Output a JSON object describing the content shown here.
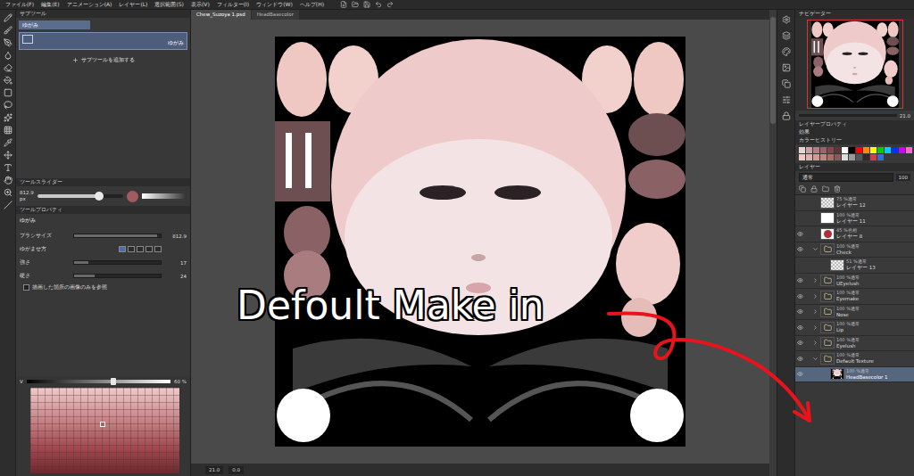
{
  "menu": [
    "ファイル(F)",
    "編集(E)",
    "アニメーション(A)",
    "レイヤー(L)",
    "選択範囲(S)",
    "表示(V)",
    "フィルター(I)",
    "ウィンドウ(W)",
    "ヘルプ(H)"
  ],
  "subtool": {
    "title": "サブツール",
    "group": "ゆがみ",
    "item": "ゆがみ",
    "add": "サブツールを追加する"
  },
  "tool_slider": {
    "title": "ツールスライダー",
    "value": "812.9",
    "unit": "px",
    "level": 0.72
  },
  "tool_property": {
    "title": "ツールプロパティ",
    "tool": "ゆがみ",
    "rows": [
      {
        "kind": "slider",
        "label": "ブラシサイズ",
        "value": "812.9",
        "level": 0.96
      },
      {
        "kind": "mode",
        "label": "ゆがませ方"
      },
      {
        "kind": "slider",
        "label": "強さ",
        "value": "17",
        "level": 0.17
      },
      {
        "kind": "slider",
        "label": "硬さ",
        "value": "24",
        "level": 0.24
      },
      {
        "kind": "checkbox",
        "label": "描画した箇所の画像のみを参照",
        "checked": false
      }
    ]
  },
  "color": {
    "label": "V",
    "value": "60 %",
    "level": 0.6
  },
  "document_tabs": [
    {
      "label": "Chew_Suzoya 1.psd",
      "selected": true
    },
    {
      "label": "HeadBasecolor",
      "selected": false
    }
  ],
  "canvas": {
    "annotation": "Defoult Make in"
  },
  "status": {
    "zoom": "21.0",
    "angle": "0.0"
  },
  "navigator": {
    "title": "ナビゲーター",
    "zoom": "21.0"
  },
  "panels": [
    "レイヤープロパティ",
    "効果",
    "カラーヒストリー"
  ],
  "color_history": [
    "#e8d6d6",
    "#c8a2a4",
    "#b07f83",
    "#9a6468",
    "#7e4a4e",
    "#5e3538",
    "#ffffff",
    "#000000",
    "#ff0000",
    "#ff8800",
    "#ffff00",
    "#00cc00",
    "#00ccff",
    "#0033ff",
    "#cc00ff",
    "#ff66cc",
    "#f0c8c4",
    "#e0b0ac",
    "#d59a96",
    "#c48480",
    "#a86e6a",
    "#8c5a56",
    "#dddddd",
    "#999999",
    "#555555",
    "#2a2a2a",
    "#d04040",
    "#3070d0"
  ],
  "layers": {
    "title": "レイヤー",
    "blend": "通常",
    "opacity": "100",
    "rows": [
      {
        "opacity": "75 %",
        "mode": "通常",
        "name": "レイヤー 12",
        "kind": "raster",
        "visible": false,
        "child": false,
        "expanded": false,
        "selected": false
      },
      {
        "opacity": "100 %",
        "mode": "通常",
        "name": "レイヤー 11",
        "kind": "fill",
        "color": "#ffffff",
        "visible": false,
        "child": false,
        "expanded": false,
        "selected": false
      },
      {
        "opacity": "45 %",
        "mode": "色相",
        "name": "レイヤー 8",
        "kind": "fill",
        "color": "#b0303a",
        "visible": true,
        "child": false,
        "expanded": false,
        "selected": false
      },
      {
        "opacity": "100 %",
        "mode": "通常",
        "name": "Check",
        "kind": "folder",
        "visible": true,
        "child": false,
        "expanded": true,
        "selected": false
      },
      {
        "opacity": "51 %",
        "mode": "通常",
        "name": "レイヤー 13",
        "kind": "raster",
        "visible": false,
        "child": true,
        "expanded": false,
        "selected": false
      },
      {
        "opacity": "100 %",
        "mode": "通常",
        "name": "UEyelush",
        "kind": "folder",
        "visible": true,
        "child": false,
        "expanded": false,
        "selected": false
      },
      {
        "opacity": "100 %",
        "mode": "通常",
        "name": "Eyemake",
        "kind": "folder",
        "visible": true,
        "child": false,
        "expanded": false,
        "selected": false
      },
      {
        "opacity": "100 %",
        "mode": "通常",
        "name": "Nose",
        "kind": "folder",
        "visible": true,
        "child": false,
        "expanded": false,
        "selected": false
      },
      {
        "opacity": "100 %",
        "mode": "通常",
        "name": "Lip",
        "kind": "folder",
        "visible": true,
        "child": false,
        "expanded": false,
        "selected": false
      },
      {
        "opacity": "100 %",
        "mode": "通常",
        "name": "Eyelush",
        "kind": "folder",
        "visible": true,
        "child": false,
        "expanded": false,
        "selected": false
      },
      {
        "opacity": "100 %",
        "mode": "通常",
        "name": "Default Texture",
        "kind": "folder",
        "visible": true,
        "child": false,
        "expanded": true,
        "selected": false
      },
      {
        "opacity": "100 %",
        "mode": "通常",
        "name": "HeadBasecolor 1",
        "kind": "image",
        "visible": true,
        "child": true,
        "expanded": false,
        "selected": true
      }
    ]
  }
}
